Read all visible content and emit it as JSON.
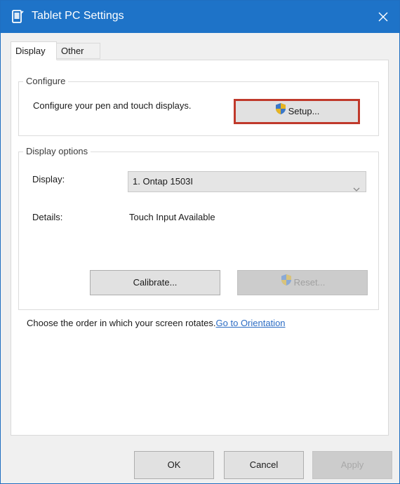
{
  "window": {
    "title": "Tablet PC Settings"
  },
  "tabs": [
    {
      "label": "Display",
      "selected": true
    },
    {
      "label": "Other",
      "selected": false
    }
  ],
  "configure": {
    "group_label": "Configure",
    "description": "Configure your pen and touch displays.",
    "setup_label": "Setup..."
  },
  "display_options": {
    "group_label": "Display options",
    "display_label": "Display:",
    "display_value": "1. Ontap 1503I",
    "details_label": "Details:",
    "details_value": "Touch Input Available",
    "calibrate_label": "Calibrate...",
    "reset_label": "Reset..."
  },
  "orientation": {
    "text": "Choose the order in which your screen rotates.",
    "link_text": "Go to Orientation"
  },
  "footer": {
    "ok_label": "OK",
    "cancel_label": "Cancel",
    "apply_label": "Apply"
  },
  "colors": {
    "titlebar": "#1e73c8",
    "highlight_border": "#c0392b",
    "link": "#2b6cc4"
  },
  "icons": {
    "title": "tablet-pc-icon",
    "close": "close-icon",
    "shield": "uac-shield-icon",
    "dropdown": "chevron-down-icon"
  }
}
